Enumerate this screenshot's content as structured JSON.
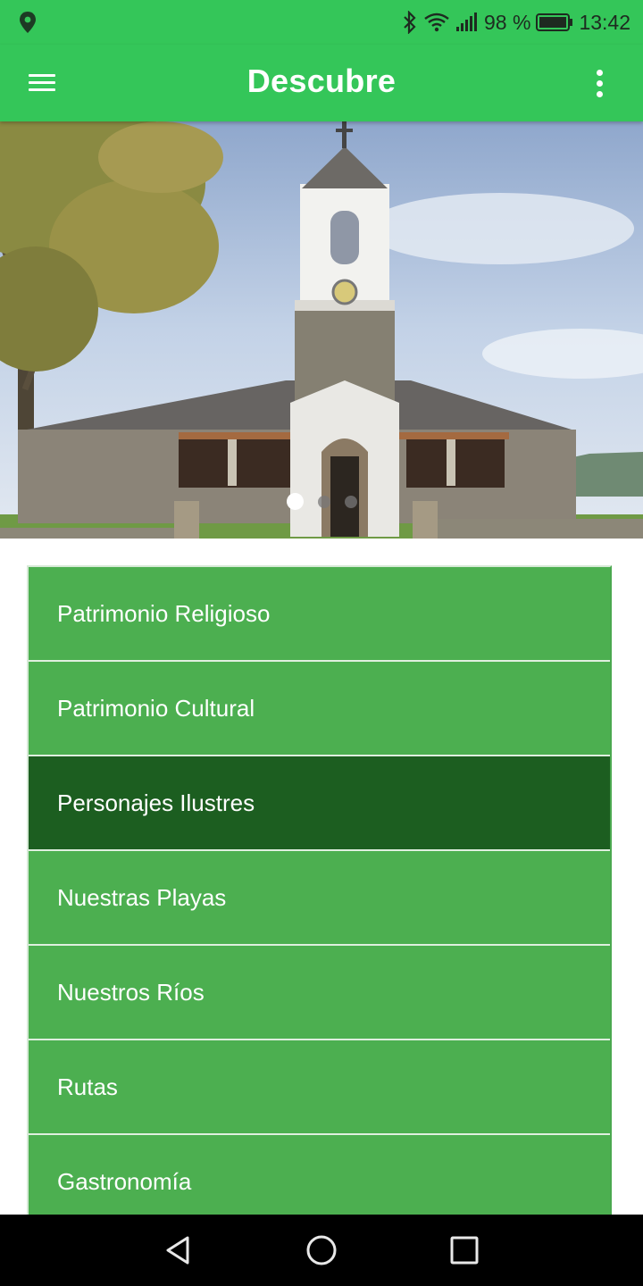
{
  "status_bar": {
    "battery_text": "98 %",
    "time": "13:42",
    "icons": [
      "location-icon",
      "bluetooth-icon",
      "wifi-icon",
      "signal-icon",
      "battery-icon"
    ]
  },
  "app_bar": {
    "title": "Descubre",
    "icons": [
      "menu-icon",
      "more-vert-icon"
    ]
  },
  "carousel": {
    "image": "church-photo",
    "slide_count": 3,
    "active_slide": 1
  },
  "menu": {
    "items": [
      {
        "label": "Patrimonio Religioso",
        "selected": false
      },
      {
        "label": "Patrimonio Cultural",
        "selected": false
      },
      {
        "label": "Personajes Ilustres",
        "selected": true
      },
      {
        "label": "Nuestras Playas",
        "selected": false
      },
      {
        "label": "Nuestros Ríos",
        "selected": false
      },
      {
        "label": "Rutas",
        "selected": false
      },
      {
        "label": "Gastronomía",
        "selected": false
      }
    ]
  },
  "nav_bar": {
    "icons": [
      "back-icon",
      "home-icon",
      "recents-icon"
    ]
  },
  "colors": {
    "app_bar": "#34c659",
    "item": "#4caf50",
    "item_selected": "#1c5e20",
    "nav_bar": "#000000"
  }
}
